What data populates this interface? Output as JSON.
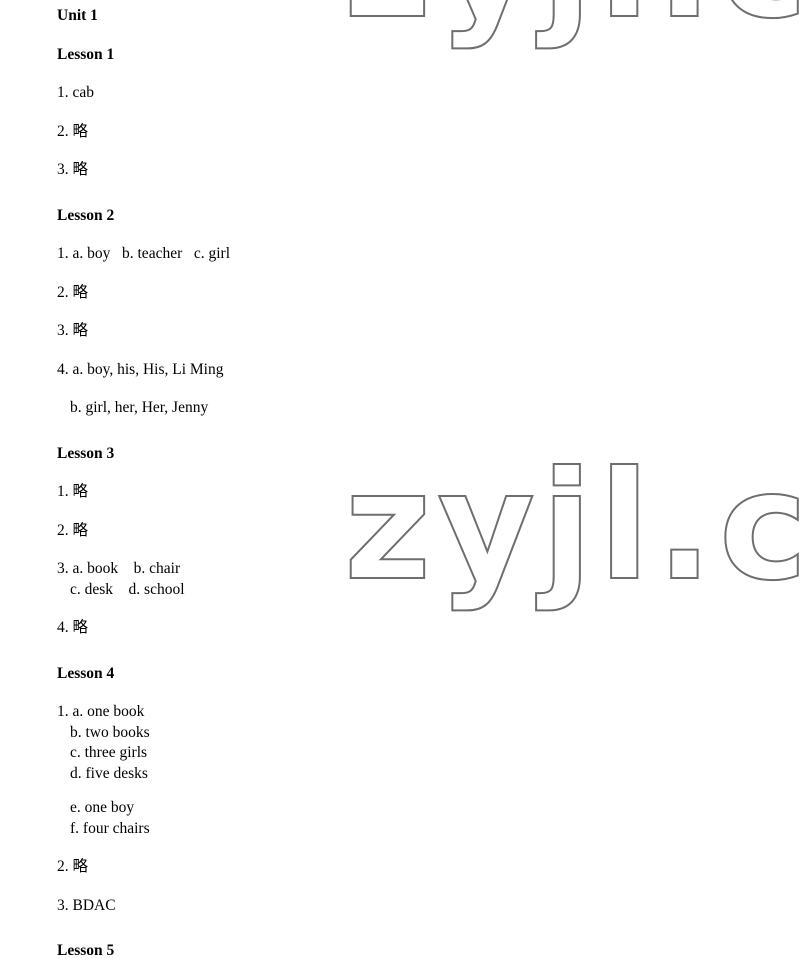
{
  "document": {
    "unit_title": "Unit 1",
    "lessons": [
      {
        "title": "Lesson 1",
        "items": [
          {
            "lines": [
              "1. cab"
            ]
          },
          {
            "lines": [
              "2. 略"
            ]
          },
          {
            "lines": [
              "3. 略"
            ]
          }
        ]
      },
      {
        "title": "Lesson 2",
        "items": [
          {
            "lines": [
              "1. a. boy   b. teacher   c. girl"
            ]
          },
          {
            "lines": [
              "2. 略"
            ]
          },
          {
            "lines": [
              "3. 略"
            ]
          },
          {
            "lines": [
              "4. a. boy, his, His, Li Ming",
              "b. girl, her, Her, Jenny"
            ]
          }
        ]
      },
      {
        "title": "Lesson 3",
        "items": [
          {
            "lines": [
              "1. 略"
            ]
          },
          {
            "lines": [
              "2. 略"
            ]
          },
          {
            "lines": [
              "3. a. book    b. chair",
              "c. desk    d. school"
            ]
          },
          {
            "lines": [
              "4. 略"
            ]
          }
        ]
      },
      {
        "title": "Lesson 4",
        "items": [
          {
            "lines": [
              "1. a. one book",
              "b. two books",
              "c. three girls",
              "d. five desks",
              "e. one boy",
              "f. four chairs"
            ]
          },
          {
            "lines": [
              "2. 略"
            ]
          },
          {
            "lines": [
              "3. BDAC"
            ]
          }
        ]
      },
      {
        "title": "Lesson 5",
        "items": []
      }
    ]
  },
  "watermark": {
    "main_text": "zyjl.cn",
    "top_text": "zyjl.cn",
    "stroke_color": "#6e6e6e"
  }
}
